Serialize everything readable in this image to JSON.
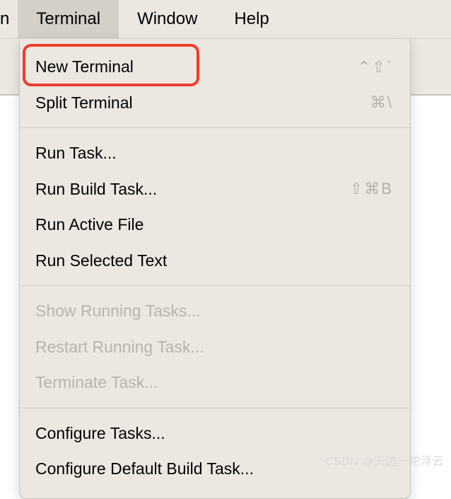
{
  "menubar": {
    "partial_item": "n",
    "items": [
      "Terminal",
      "Window",
      "Help"
    ],
    "active_index": 0
  },
  "menu": {
    "groups": [
      [
        {
          "label": "New Terminal",
          "shortcut": "⌃⇧`",
          "disabled": false
        },
        {
          "label": "Split Terminal",
          "shortcut": "⌘\\",
          "disabled": false
        }
      ],
      [
        {
          "label": "Run Task...",
          "shortcut": "",
          "disabled": false
        },
        {
          "label": "Run Build Task...",
          "shortcut": "⇧⌘B",
          "disabled": false
        },
        {
          "label": "Run Active File",
          "shortcut": "",
          "disabled": false
        },
        {
          "label": "Run Selected Text",
          "shortcut": "",
          "disabled": false
        }
      ],
      [
        {
          "label": "Show Running Tasks...",
          "shortcut": "",
          "disabled": true
        },
        {
          "label": "Restart Running Task...",
          "shortcut": "",
          "disabled": true
        },
        {
          "label": "Terminate Task...",
          "shortcut": "",
          "disabled": true
        }
      ],
      [
        {
          "label": "Configure Tasks...",
          "shortcut": "",
          "disabled": false
        },
        {
          "label": "Configure Default Build Task...",
          "shortcut": "",
          "disabled": false
        }
      ]
    ]
  },
  "watermark": "CSDN @天边一坨浮云"
}
